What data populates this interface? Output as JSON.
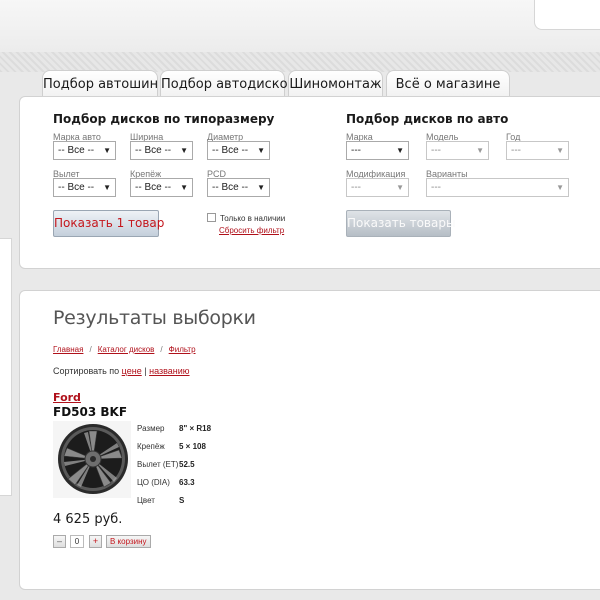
{
  "tabs": [
    "Подбор автошин",
    "Подбор автодисков",
    "Шиномонтаж",
    "Всё о магазине"
  ],
  "filter_by_size": {
    "title": "Подбор дисков по типоразмеру",
    "fields": [
      {
        "label": "Марка авто",
        "value": "-- Все --"
      },
      {
        "label": "Ширина",
        "value": "-- Все --"
      },
      {
        "label": "Диаметр",
        "value": "-- Все --"
      },
      {
        "label": "Вылет",
        "value": "-- Все --"
      },
      {
        "label": "Крепёж",
        "value": "-- Все --"
      },
      {
        "label": "PCD",
        "value": "-- Все --"
      }
    ],
    "in_stock_label": "Только в наличии",
    "in_stock_checked": false,
    "reset_label": "Сбросить фильтр",
    "submit_label": "Показать 1 товар"
  },
  "filter_by_car": {
    "title": "Подбор дисков по авто",
    "fields": [
      {
        "label": "Марка",
        "value": "---"
      },
      {
        "label": "Модель",
        "value": "---"
      },
      {
        "label": "Год",
        "value": "---"
      },
      {
        "label": "Модификация",
        "value": "---"
      },
      {
        "label": "Варианты",
        "value": "---"
      }
    ],
    "submit_label": "Показать товары"
  },
  "results": {
    "title": "Результаты выборки",
    "breadcrumbs": [
      "Главная",
      "Каталог дисков",
      "Фильтр"
    ],
    "breadcrumb_separator": "/",
    "sort_prefix": "Сортировать по",
    "sort_options": [
      "цене",
      "названию"
    ],
    "sort_separator": "|",
    "product": {
      "brand": "Ford",
      "model": "FD503 BKF",
      "image_icon": "wheel-rim-icon",
      "specs": [
        {
          "label": "Размер",
          "value": "8\" × R18"
        },
        {
          "label": "Крепёж",
          "value": "5 × 108"
        },
        {
          "label": "Вылет (ET)",
          "value": "52.5"
        },
        {
          "label": "ЦО (DIA)",
          "value": "63.3"
        },
        {
          "label": "Цвет",
          "value": "S"
        }
      ],
      "price": "4 625 руб.",
      "quantity": "0",
      "minus_label": "–",
      "plus_label": "+",
      "cart_label": "В корзину"
    }
  },
  "colors": {
    "accent_red": "#c4161c",
    "link_red": "#b0101a",
    "page_bg": "#e9e9e9"
  }
}
